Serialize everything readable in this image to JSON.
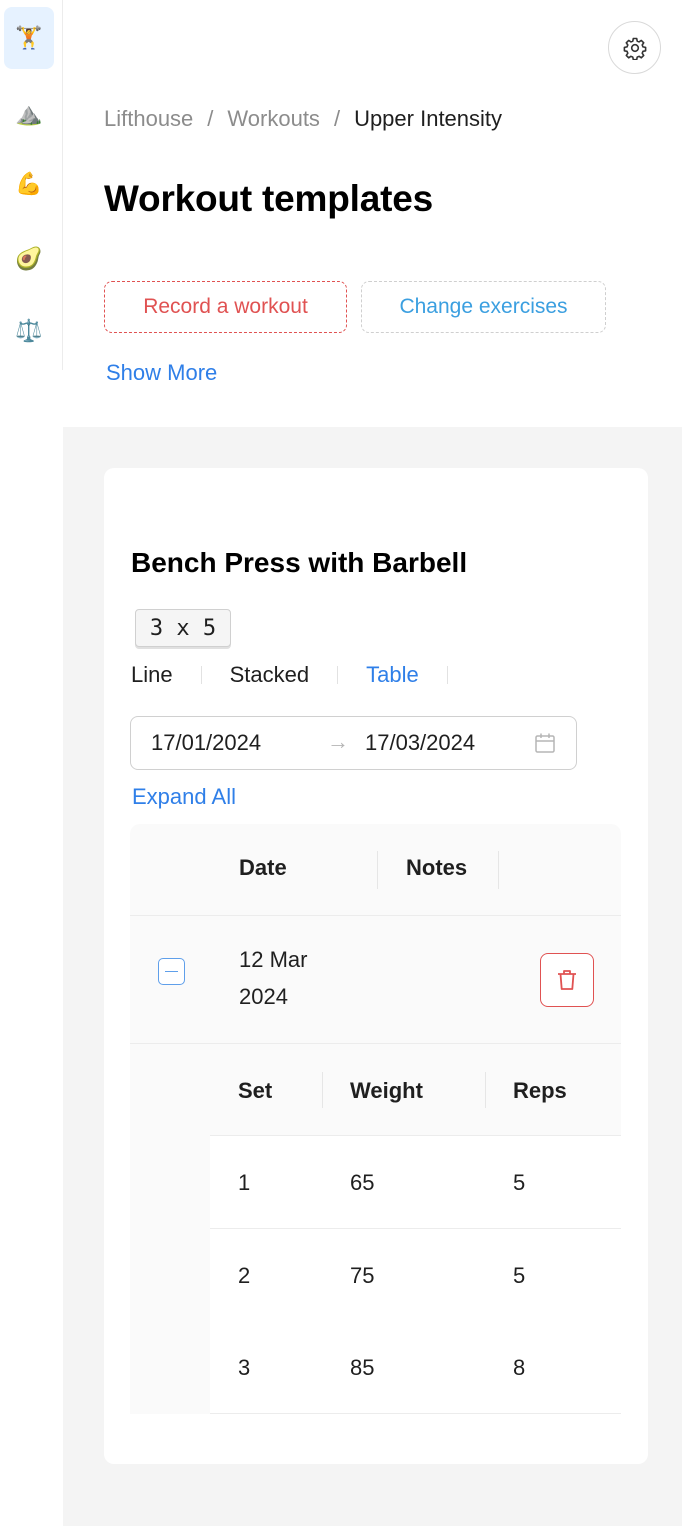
{
  "nav": {
    "items": [
      {
        "name": "workouts",
        "icon": "🏋️",
        "active": true
      },
      {
        "name": "mountain",
        "icon": "⛰️",
        "active": false
      },
      {
        "name": "muscle",
        "icon": "💪",
        "active": false
      },
      {
        "name": "nutrition",
        "icon": "🥑",
        "active": false
      },
      {
        "name": "weight",
        "icon": "⚖️",
        "active": false
      }
    ]
  },
  "header": {
    "settings_icon": "gear-icon"
  },
  "breadcrumb": {
    "items": [
      "Lifthouse",
      "Workouts",
      "Upper Intensity"
    ],
    "separator": "/"
  },
  "page": {
    "title": "Workout templates",
    "record_label": "Record a workout",
    "change_label": "Change exercises",
    "show_more_label": "Show More"
  },
  "exercise": {
    "title": "Bench Press with Barbell",
    "scheme": "3 x 5",
    "view_tabs": [
      {
        "label": "Line",
        "active": false
      },
      {
        "label": "Stacked",
        "active": false
      },
      {
        "label": "Table",
        "active": true
      }
    ],
    "range": {
      "from": "17/01/2024",
      "arrow": "→",
      "to": "17/03/2024"
    },
    "expand_all_label": "Expand All",
    "table": {
      "columns": [
        "Date",
        "Notes"
      ],
      "rows": [
        {
          "date": "12 Mar 2024",
          "notes": "",
          "sets": {
            "columns": [
              "Set",
              "Weight",
              "Reps"
            ],
            "rows": [
              {
                "set": "1",
                "weight": "65",
                "reps": "5"
              },
              {
                "set": "2",
                "weight": "75",
                "reps": "5"
              },
              {
                "set": "3",
                "weight": "85",
                "reps": "8"
              }
            ]
          }
        }
      ]
    }
  },
  "colors": {
    "accent": "#2f7fe8",
    "danger": "#e05252",
    "link_light": "#3b9fe0"
  }
}
